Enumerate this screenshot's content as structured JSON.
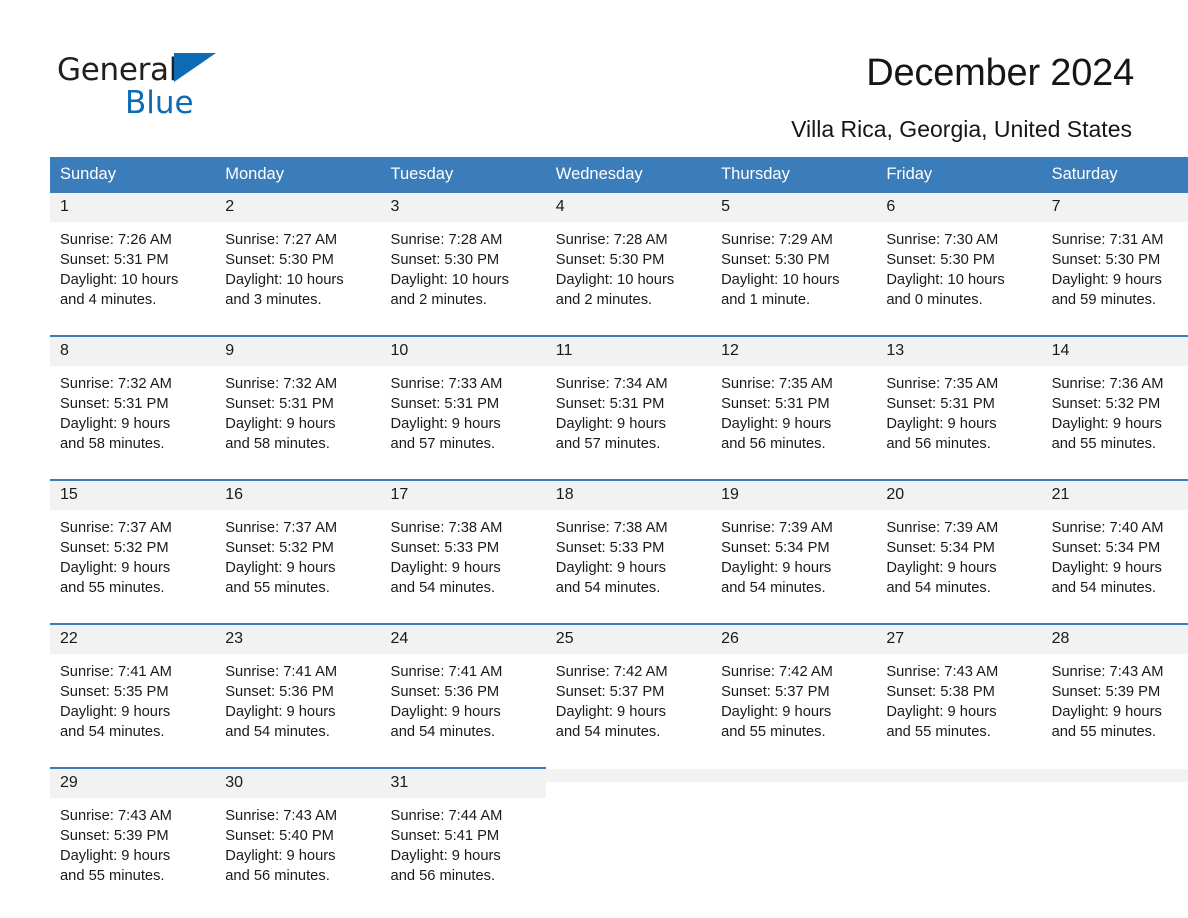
{
  "brand": {
    "name_part1": "General",
    "name_part2": "Blue",
    "accent_color": "#0d6cb3",
    "triangle_icon": "brand-triangle-icon"
  },
  "header": {
    "title": "December 2024",
    "subtitle": "Villa Rica, Georgia, United States"
  },
  "calendar": {
    "header_bg": "#3b7cba",
    "daynum_bg": "#f2f2f2",
    "weekday_headers": [
      "Sunday",
      "Monday",
      "Tuesday",
      "Wednesday",
      "Thursday",
      "Friday",
      "Saturday"
    ],
    "weeks": [
      [
        {
          "day": "1",
          "sunrise": "Sunrise: 7:26 AM",
          "sunset": "Sunset: 5:31 PM",
          "daylight_line1": "Daylight: 10 hours",
          "daylight_line2": "and 4 minutes."
        },
        {
          "day": "2",
          "sunrise": "Sunrise: 7:27 AM",
          "sunset": "Sunset: 5:30 PM",
          "daylight_line1": "Daylight: 10 hours",
          "daylight_line2": "and 3 minutes."
        },
        {
          "day": "3",
          "sunrise": "Sunrise: 7:28 AM",
          "sunset": "Sunset: 5:30 PM",
          "daylight_line1": "Daylight: 10 hours",
          "daylight_line2": "and 2 minutes."
        },
        {
          "day": "4",
          "sunrise": "Sunrise: 7:28 AM",
          "sunset": "Sunset: 5:30 PM",
          "daylight_line1": "Daylight: 10 hours",
          "daylight_line2": "and 2 minutes."
        },
        {
          "day": "5",
          "sunrise": "Sunrise: 7:29 AM",
          "sunset": "Sunset: 5:30 PM",
          "daylight_line1": "Daylight: 10 hours",
          "daylight_line2": "and 1 minute."
        },
        {
          "day": "6",
          "sunrise": "Sunrise: 7:30 AM",
          "sunset": "Sunset: 5:30 PM",
          "daylight_line1": "Daylight: 10 hours",
          "daylight_line2": "and 0 minutes."
        },
        {
          "day": "7",
          "sunrise": "Sunrise: 7:31 AM",
          "sunset": "Sunset: 5:30 PM",
          "daylight_line1": "Daylight: 9 hours",
          "daylight_line2": "and 59 minutes."
        }
      ],
      [
        {
          "day": "8",
          "sunrise": "Sunrise: 7:32 AM",
          "sunset": "Sunset: 5:31 PM",
          "daylight_line1": "Daylight: 9 hours",
          "daylight_line2": "and 58 minutes."
        },
        {
          "day": "9",
          "sunrise": "Sunrise: 7:32 AM",
          "sunset": "Sunset: 5:31 PM",
          "daylight_line1": "Daylight: 9 hours",
          "daylight_line2": "and 58 minutes."
        },
        {
          "day": "10",
          "sunrise": "Sunrise: 7:33 AM",
          "sunset": "Sunset: 5:31 PM",
          "daylight_line1": "Daylight: 9 hours",
          "daylight_line2": "and 57 minutes."
        },
        {
          "day": "11",
          "sunrise": "Sunrise: 7:34 AM",
          "sunset": "Sunset: 5:31 PM",
          "daylight_line1": "Daylight: 9 hours",
          "daylight_line2": "and 57 minutes."
        },
        {
          "day": "12",
          "sunrise": "Sunrise: 7:35 AM",
          "sunset": "Sunset: 5:31 PM",
          "daylight_line1": "Daylight: 9 hours",
          "daylight_line2": "and 56 minutes."
        },
        {
          "day": "13",
          "sunrise": "Sunrise: 7:35 AM",
          "sunset": "Sunset: 5:31 PM",
          "daylight_line1": "Daylight: 9 hours",
          "daylight_line2": "and 56 minutes."
        },
        {
          "day": "14",
          "sunrise": "Sunrise: 7:36 AM",
          "sunset": "Sunset: 5:32 PM",
          "daylight_line1": "Daylight: 9 hours",
          "daylight_line2": "and 55 minutes."
        }
      ],
      [
        {
          "day": "15",
          "sunrise": "Sunrise: 7:37 AM",
          "sunset": "Sunset: 5:32 PM",
          "daylight_line1": "Daylight: 9 hours",
          "daylight_line2": "and 55 minutes."
        },
        {
          "day": "16",
          "sunrise": "Sunrise: 7:37 AM",
          "sunset": "Sunset: 5:32 PM",
          "daylight_line1": "Daylight: 9 hours",
          "daylight_line2": "and 55 minutes."
        },
        {
          "day": "17",
          "sunrise": "Sunrise: 7:38 AM",
          "sunset": "Sunset: 5:33 PM",
          "daylight_line1": "Daylight: 9 hours",
          "daylight_line2": "and 54 minutes."
        },
        {
          "day": "18",
          "sunrise": "Sunrise: 7:38 AM",
          "sunset": "Sunset: 5:33 PM",
          "daylight_line1": "Daylight: 9 hours",
          "daylight_line2": "and 54 minutes."
        },
        {
          "day": "19",
          "sunrise": "Sunrise: 7:39 AM",
          "sunset": "Sunset: 5:34 PM",
          "daylight_line1": "Daylight: 9 hours",
          "daylight_line2": "and 54 minutes."
        },
        {
          "day": "20",
          "sunrise": "Sunrise: 7:39 AM",
          "sunset": "Sunset: 5:34 PM",
          "daylight_line1": "Daylight: 9 hours",
          "daylight_line2": "and 54 minutes."
        },
        {
          "day": "21",
          "sunrise": "Sunrise: 7:40 AM",
          "sunset": "Sunset: 5:34 PM",
          "daylight_line1": "Daylight: 9 hours",
          "daylight_line2": "and 54 minutes."
        }
      ],
      [
        {
          "day": "22",
          "sunrise": "Sunrise: 7:41 AM",
          "sunset": "Sunset: 5:35 PM",
          "daylight_line1": "Daylight: 9 hours",
          "daylight_line2": "and 54 minutes."
        },
        {
          "day": "23",
          "sunrise": "Sunrise: 7:41 AM",
          "sunset": "Sunset: 5:36 PM",
          "daylight_line1": "Daylight: 9 hours",
          "daylight_line2": "and 54 minutes."
        },
        {
          "day": "24",
          "sunrise": "Sunrise: 7:41 AM",
          "sunset": "Sunset: 5:36 PM",
          "daylight_line1": "Daylight: 9 hours",
          "daylight_line2": "and 54 minutes."
        },
        {
          "day": "25",
          "sunrise": "Sunrise: 7:42 AM",
          "sunset": "Sunset: 5:37 PM",
          "daylight_line1": "Daylight: 9 hours",
          "daylight_line2": "and 54 minutes."
        },
        {
          "day": "26",
          "sunrise": "Sunrise: 7:42 AM",
          "sunset": "Sunset: 5:37 PM",
          "daylight_line1": "Daylight: 9 hours",
          "daylight_line2": "and 55 minutes."
        },
        {
          "day": "27",
          "sunrise": "Sunrise: 7:43 AM",
          "sunset": "Sunset: 5:38 PM",
          "daylight_line1": "Daylight: 9 hours",
          "daylight_line2": "and 55 minutes."
        },
        {
          "day": "28",
          "sunrise": "Sunrise: 7:43 AM",
          "sunset": "Sunset: 5:39 PM",
          "daylight_line1": "Daylight: 9 hours",
          "daylight_line2": "and 55 minutes."
        }
      ],
      [
        {
          "day": "29",
          "sunrise": "Sunrise: 7:43 AM",
          "sunset": "Sunset: 5:39 PM",
          "daylight_line1": "Daylight: 9 hours",
          "daylight_line2": "and 55 minutes."
        },
        {
          "day": "30",
          "sunrise": "Sunrise: 7:43 AM",
          "sunset": "Sunset: 5:40 PM",
          "daylight_line1": "Daylight: 9 hours",
          "daylight_line2": "and 56 minutes."
        },
        {
          "day": "31",
          "sunrise": "Sunrise: 7:44 AM",
          "sunset": "Sunset: 5:41 PM",
          "daylight_line1": "Daylight: 9 hours",
          "daylight_line2": "and 56 minutes."
        },
        {
          "day": "",
          "sunrise": "",
          "sunset": "",
          "daylight_line1": "",
          "daylight_line2": ""
        },
        {
          "day": "",
          "sunrise": "",
          "sunset": "",
          "daylight_line1": "",
          "daylight_line2": ""
        },
        {
          "day": "",
          "sunrise": "",
          "sunset": "",
          "daylight_line1": "",
          "daylight_line2": ""
        },
        {
          "day": "",
          "sunrise": "",
          "sunset": "",
          "daylight_line1": "",
          "daylight_line2": ""
        }
      ]
    ]
  }
}
